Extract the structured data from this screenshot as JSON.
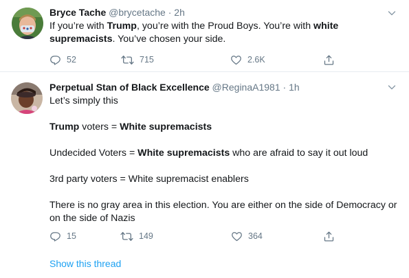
{
  "tweets": [
    {
      "name": "Bryce Tache",
      "handle": "@brycetache",
      "dot": "·",
      "time": "2h",
      "text": [
        [
          {
            "t": "If you’re with ",
            "b": false
          },
          {
            "t": "Trump",
            "b": true
          },
          {
            "t": ", you’re with the Proud Boys. You’re with ",
            "b": false
          },
          {
            "t": "white supremacists",
            "b": true
          },
          {
            "t": ". You’ve chosen your side.",
            "b": false
          }
        ]
      ],
      "replies": "52",
      "retweets": "715",
      "likes": "2.6K"
    },
    {
      "name": "Perpetual Stan of Black Excellence",
      "handle": "@ReginaA1981",
      "dot": "·",
      "time": "1h",
      "text": [
        [
          {
            "t": "Let’s simply this",
            "b": false
          }
        ],
        [],
        [
          {
            "t": "Trump",
            "b": true
          },
          {
            "t": " voters = ",
            "b": false
          },
          {
            "t": "White supremacists",
            "b": true
          }
        ],
        [],
        [
          {
            "t": "Undecided Voters = ",
            "b": false
          },
          {
            "t": "White supremacists",
            "b": true
          },
          {
            "t": " who are afraid to say it out loud",
            "b": false
          }
        ],
        [],
        [
          {
            "t": "3rd party voters = White supremacist enablers",
            "b": false
          }
        ],
        [],
        [
          {
            "t": "There is no gray area in this election. You are either on the side of Democracy or on the side of Nazis",
            "b": false
          }
        ]
      ],
      "replies": "15",
      "retweets": "149",
      "likes": "364",
      "show_thread": "Show this thread"
    }
  ],
  "icons": {
    "reply": "reply-icon",
    "retweet": "retweet-icon",
    "like": "heart-icon",
    "share": "share-icon",
    "caret": "chevron-down-icon"
  },
  "colors": {
    "text": "#14171a",
    "secondary": "#657786",
    "link": "#1da1f2",
    "divider": "#e6ecf0"
  }
}
